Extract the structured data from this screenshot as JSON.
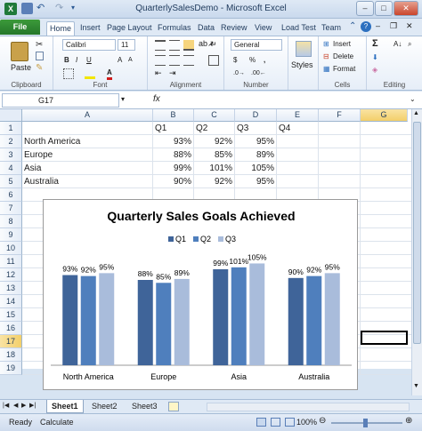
{
  "title": "QuarterlySalesDemo - Microsoft Excel",
  "tabs": [
    "File",
    "Home",
    "Insert",
    "Page Layout",
    "Formulas",
    "Data",
    "Review",
    "View",
    "Load Test",
    "Team"
  ],
  "ribbon": {
    "font_name": "Calibri",
    "font_size": "11",
    "number_format": "General",
    "paste_label": "Paste",
    "styles_label": "Styles",
    "insert_label": "Insert",
    "delete_label": "Delete",
    "format_label": "Format",
    "groups": [
      "Clipboard",
      "Font",
      "Alignment",
      "Number",
      "Cells",
      "Editing"
    ],
    "currency_symbol": "$",
    "percent_symbol": "%"
  },
  "formula_bar": {
    "name_box": "G17",
    "fx": "fx",
    "formula": ""
  },
  "columns": [
    "A",
    "B",
    "C",
    "D",
    "E",
    "F",
    "G"
  ],
  "rows": [
    "1",
    "2",
    "3",
    "4",
    "5",
    "6",
    "7",
    "8",
    "9",
    "10",
    "11",
    "12",
    "13",
    "14",
    "15",
    "16",
    "17",
    "18",
    "19"
  ],
  "sheet": {
    "headers": [
      "Q1",
      "Q2",
      "Q3",
      "Q4"
    ],
    "data": [
      {
        "region": "North America",
        "q1": "93%",
        "q2": "92%",
        "q3": "95%"
      },
      {
        "region": "Europe",
        "q1": "88%",
        "q2": "85%",
        "q3": "89%"
      },
      {
        "region": "Asia",
        "q1": "99%",
        "q2": "101%",
        "q3": "105%"
      },
      {
        "region": "Australia",
        "q1": "90%",
        "q2": "92%",
        "q3": "95%"
      }
    ]
  },
  "chart_data": {
    "type": "bar",
    "title": "Quarterly Sales Goals Achieved",
    "categories": [
      "North America",
      "Europe",
      "Asia",
      "Australia"
    ],
    "series": [
      {
        "name": "Q1",
        "values": [
          93,
          88,
          99,
          90
        ],
        "labels": [
          "93%",
          "88%",
          "99%",
          "90%"
        ],
        "color": "#3f6499"
      },
      {
        "name": "Q2",
        "values": [
          92,
          85,
          101,
          92
        ],
        "labels": [
          "92%",
          "85%",
          "101%",
          "92%"
        ],
        "color": "#4f7fbd"
      },
      {
        "name": "Q3",
        "values": [
          95,
          89,
          105,
          95
        ],
        "labels": [
          "95%",
          "89%",
          "105%",
          "95%"
        ],
        "color": "#a9bcdb"
      }
    ],
    "ylim": [
      0,
      110
    ],
    "grid": false,
    "legend": "top"
  },
  "sheet_tabs": [
    "Sheet1",
    "Sheet2",
    "Sheet3"
  ],
  "status": {
    "ready": "Ready",
    "calculate": "Calculate",
    "zoom": "100%"
  }
}
